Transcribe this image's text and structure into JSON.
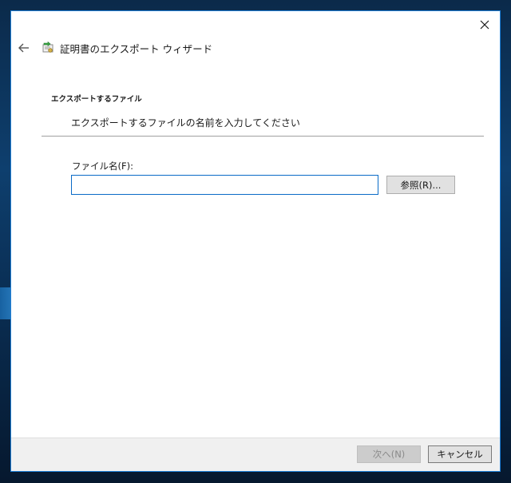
{
  "window": {
    "title": "証明書のエクスポート ウィザード"
  },
  "page": {
    "heading": "エクスポートするファイル",
    "description": "エクスポートするファイルの名前を入力してください"
  },
  "form": {
    "file_label": "ファイル名(F):",
    "file_value": "",
    "browse_label": "参照(R)..."
  },
  "footer": {
    "next_label": "次へ(N)",
    "cancel_label": "キャンセル"
  },
  "icons": {
    "close": "close-icon",
    "back": "back-arrow-icon",
    "certificate": "certificate-icon"
  },
  "colors": {
    "accent_border": "#1e7fd7",
    "input_focus_border": "#0a6bc7",
    "footer_bg": "#f0f0f0",
    "disabled_text": "#8a8a8a"
  }
}
